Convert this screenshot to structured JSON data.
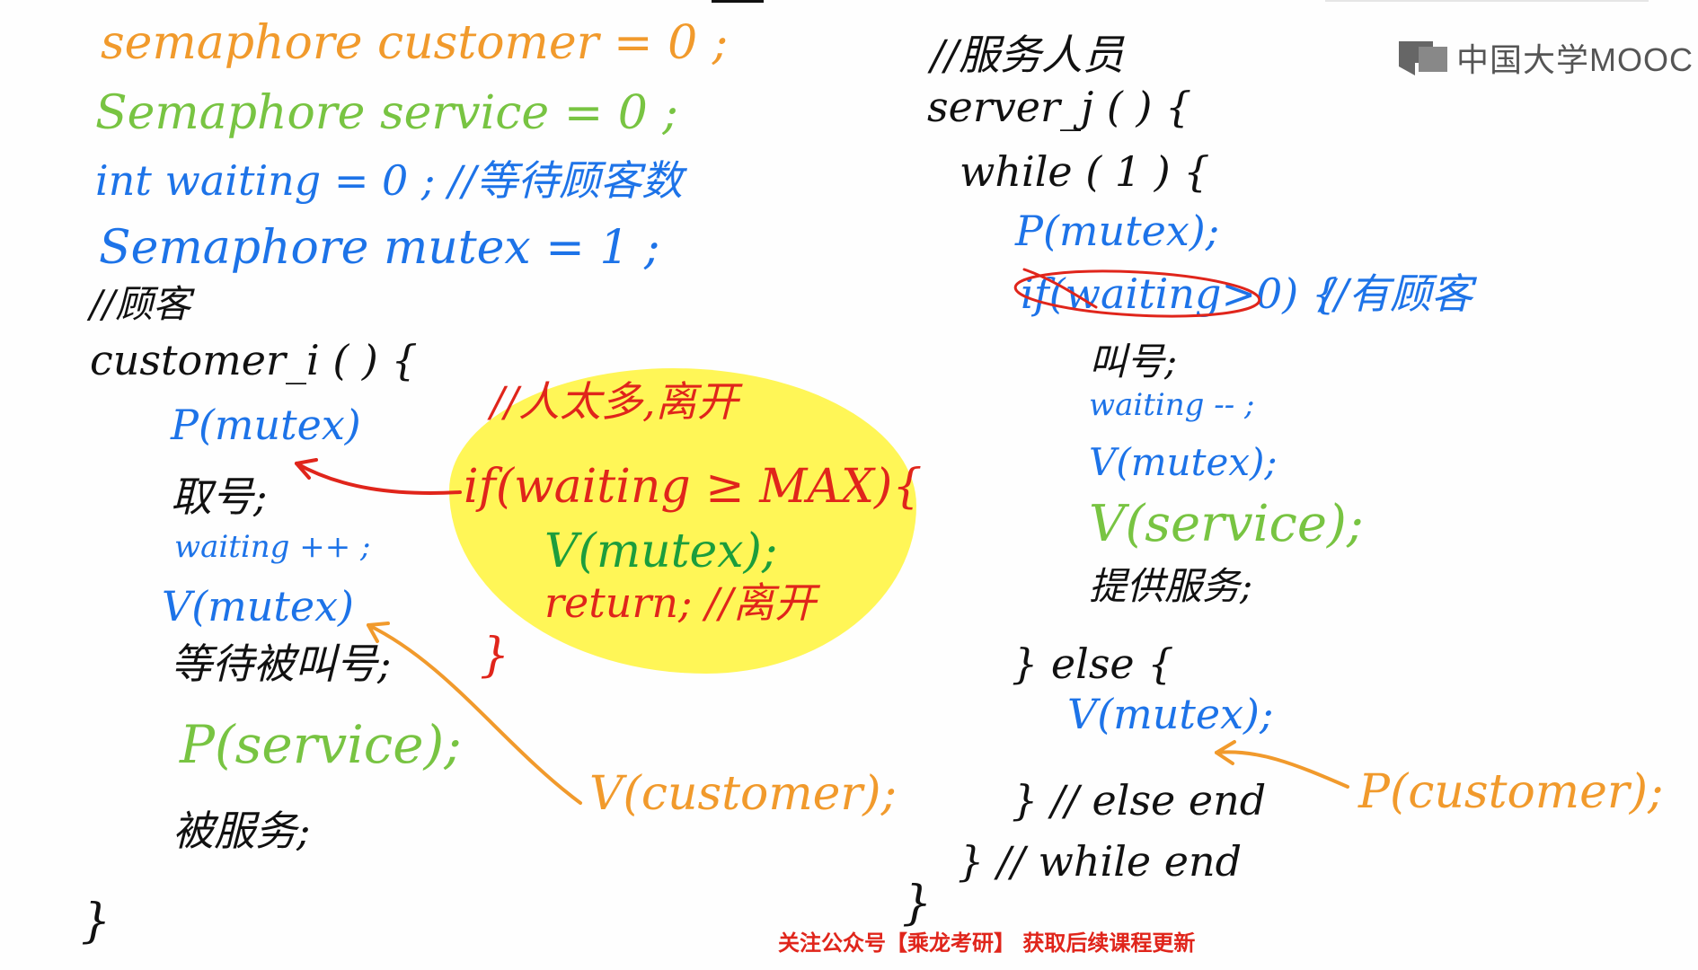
{
  "logo": {
    "text": "中国大学MOOC"
  },
  "left": {
    "line1": "semaphore customer = 0 ;",
    "line2": "Semaphore service = 0 ;",
    "line3": "int waiting = 0 ;  //等待顾客数",
    "line4": "Semaphore mutex = 1 ;",
    "comment_customer": "//顾客",
    "func": "customer_i ( ) {",
    "p_mutex": "P(mutex)",
    "take_number": "取号;",
    "waiting_inc": "waiting ++ ;",
    "v_mutex": "V(mutex)",
    "wait_call": "等待被叫号;",
    "p_service": "P(service);",
    "served": "被服务;",
    "close": "}"
  },
  "highlight": {
    "comment": "//人太多,离开",
    "if_line": "if(waiting ≥ MAX){",
    "v_mutex": "V(mutex);",
    "return_line": "return;  //离开",
    "close": "}"
  },
  "annotations": {
    "v_customer": "V(customer);",
    "p_customer": "P(customer);"
  },
  "right": {
    "comment_server": "//服务人员",
    "func": "server_j (   ) {",
    "while_line": "while ( 1 ) {",
    "p_mutex": "P(mutex);",
    "if_line": "if(waiting>0) {",
    "comment_has": "//有顾客",
    "call_number": "叫号;",
    "waiting_dec": "waiting -- ;",
    "v_mutex": "V(mutex);",
    "v_service": "V(service);",
    "provide": "提供服务;",
    "else_line": "} else {",
    "v_mutex2": "V(mutex);",
    "else_end": "}    // else end",
    "while_end": "}    // while end",
    "close": "}"
  },
  "footer": {
    "text": "关注公众号【乘龙考研】 获取后续课程更新"
  },
  "colors": {
    "orange": "#f19a2c",
    "green": "#78c442",
    "blue": "#1d73e8",
    "black": "#111111",
    "red": "#e0251b",
    "dark_green": "#1c9d3c",
    "highlight": "#fff53a"
  }
}
